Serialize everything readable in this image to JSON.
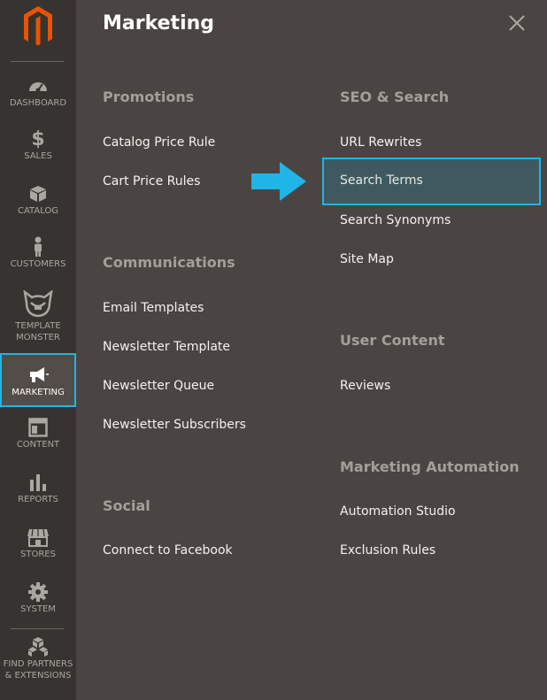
{
  "brand": {
    "logo_icon": "magento-logo-icon",
    "logo_color": "#eb5202"
  },
  "sidebar": {
    "items": [
      {
        "label": "DASHBOARD",
        "icon": "dashboard-icon"
      },
      {
        "label": "SALES",
        "icon": "dollar-icon"
      },
      {
        "label": "CATALOG",
        "icon": "box-icon"
      },
      {
        "label": "CUSTOMERS",
        "icon": "person-icon"
      },
      {
        "label": "TEMPLATE\nMONSTER",
        "icon": "monster-icon"
      },
      {
        "label": "MARKETING",
        "icon": "megaphone-icon",
        "active": true
      },
      {
        "label": "CONTENT",
        "icon": "layout-icon"
      },
      {
        "label": "REPORTS",
        "icon": "bar-chart-icon"
      },
      {
        "label": "STORES",
        "icon": "storefront-icon"
      },
      {
        "label": "SYSTEM",
        "icon": "gear-icon"
      },
      {
        "label": "FIND PARTNERS\n& EXTENSIONS",
        "icon": "cubes-icon"
      }
    ]
  },
  "panel": {
    "title": "Marketing",
    "close_icon": "close-icon",
    "promotions": {
      "title": "Promotions",
      "links": [
        "Catalog Price Rule",
        "Cart Price Rules"
      ]
    },
    "communications": {
      "title": "Communications",
      "links": [
        "Email Templates",
        "Newsletter Template",
        "Newsletter Queue",
        "Newsletter Subscribers"
      ]
    },
    "social": {
      "title": "Social",
      "links": [
        "Connect to Facebook"
      ]
    },
    "seo": {
      "title": "SEO & Search",
      "links": [
        "URL Rewrites",
        "Search Terms",
        "Search Synonyms",
        "Site Map"
      ]
    },
    "user_content": {
      "title": "User Content",
      "links": [
        "Reviews"
      ]
    },
    "automation": {
      "title": "Marketing Automation",
      "links": [
        "Automation Studio",
        "Exclusion Rules"
      ]
    }
  },
  "colors": {
    "accent": "#1fb5e6",
    "panel_bg": "#4a4542",
    "sidebar_bg": "#373330"
  },
  "annotation": {
    "arrow_icon": "arrow-right-icon"
  }
}
